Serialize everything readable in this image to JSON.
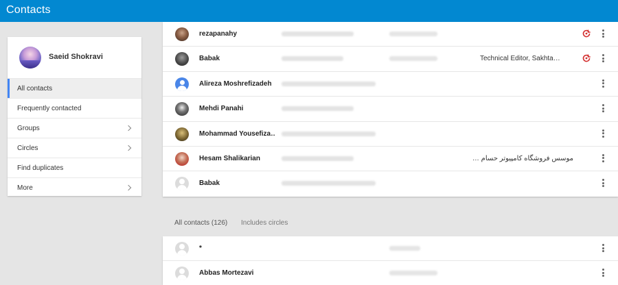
{
  "app": {
    "title": "Contacts"
  },
  "profile": {
    "name": "Saeid Shokravi"
  },
  "nav": [
    {
      "label": "All contacts",
      "active": true,
      "chevron": false
    },
    {
      "label": "Frequently contacted",
      "active": false,
      "chevron": false
    },
    {
      "label": "Groups",
      "active": false,
      "chevron": true
    },
    {
      "label": "Circles",
      "active": false,
      "chevron": true
    },
    {
      "label": "Find duplicates",
      "active": false,
      "chevron": false
    },
    {
      "label": "More",
      "active": false,
      "chevron": true
    }
  ],
  "frequent": [
    {
      "name": "rezapanahy",
      "avatar": "photo-avatar",
      "extra": "",
      "in_circles": true
    },
    {
      "name": "Babak",
      "avatar": "photo-avatar",
      "extra": "Technical Editor, Sakhta…",
      "in_circles": true
    },
    {
      "name": "Alireza Moshrefizadeh",
      "avatar": "default-avatar-blue",
      "extra": "",
      "in_circles": false
    },
    {
      "name": "Mehdi Panahi",
      "avatar": "photo-avatar",
      "extra": "",
      "in_circles": false
    },
    {
      "name": "Mohammad Yousefiza…",
      "avatar": "photo-avatar",
      "extra": "",
      "in_circles": false
    },
    {
      "name": "Hesam Shalikarian",
      "avatar": "photo-avatar",
      "extra": "موسس فروشگاه کامپیوتر حسام …",
      "in_circles": false
    },
    {
      "name": "Babak",
      "avatar": "default-avatar-gray",
      "extra": "",
      "in_circles": false
    }
  ],
  "all_contacts": {
    "title": "All contacts (126)",
    "subtitle": "Includes circles",
    "rows": [
      {
        "name": "*",
        "avatar": "default-avatar-gray"
      },
      {
        "name": "Abbas Mortezavi",
        "avatar": "default-avatar-gray"
      }
    ]
  },
  "colors": {
    "topbar": "#0288d1",
    "accent": "#4285f4",
    "circle_icon": "#d32f2f"
  }
}
